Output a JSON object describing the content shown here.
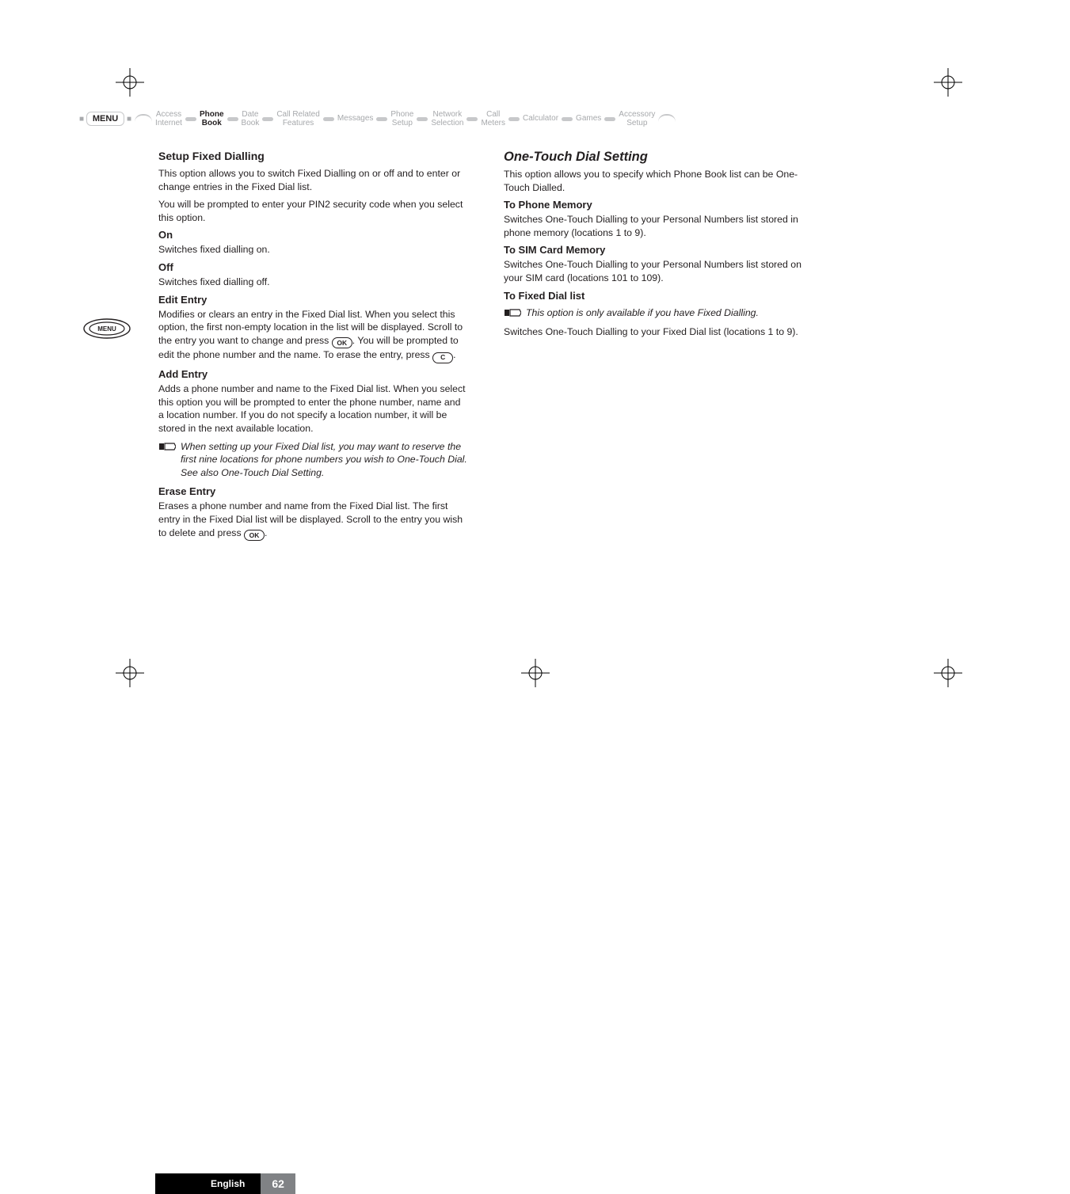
{
  "nav": {
    "menu_label": "MENU",
    "items": [
      {
        "line1": "Access",
        "line2": "Internet"
      },
      {
        "line1": "Phone",
        "line2": "Book",
        "active": true
      },
      {
        "line1": "Date",
        "line2": "Book"
      },
      {
        "line1": "Call Related",
        "line2": "Features"
      },
      {
        "line1": "Messages",
        "line2": ""
      },
      {
        "line1": "Phone",
        "line2": "Setup"
      },
      {
        "line1": "Network",
        "line2": "Selection"
      },
      {
        "line1": "Call",
        "line2": "Meters"
      },
      {
        "line1": "Calculator",
        "line2": ""
      },
      {
        "line1": "Games",
        "line2": ""
      },
      {
        "line1": "Accessory",
        "line2": "Setup"
      }
    ]
  },
  "left": {
    "setup_heading": "Setup Fixed Dialling",
    "p1": "This option allows you to switch Fixed Dialling on or off and to enter or change entries in the Fixed Dial list.",
    "p2": "You will be prompted to enter your PIN2 security code when you select this option.",
    "on_h": "On",
    "on_p": "Switches fixed dialling on.",
    "off_h": "Off",
    "off_p": "Switches fixed dialling off.",
    "edit_h": "Edit Entry",
    "edit_p_a": "Modifies or clears an entry in the Fixed Dial list. When you select this option, the first non-empty location in the list will be displayed. Scroll to the entry you want to change and press ",
    "edit_p_b": ". You will be prompted to edit the phone number and the name. To erase the entry, press ",
    "edit_p_c": ".",
    "key_ok": "OK",
    "key_c": "C",
    "add_h": "Add Entry",
    "add_p": "Adds a phone number and name to the Fixed Dial list. When you select this option you will be prompted to enter the phone number, name and a location number. If you do not specify a location number, it will be stored in the next available location.",
    "add_note": "When setting up your Fixed Dial list, you may want to reserve the first nine locations for phone numbers you wish to One-Touch Dial. See also One-Touch Dial Setting.",
    "erase_h": "Erase Entry",
    "erase_p_a": "Erases a phone number and name from the Fixed Dial list. The first entry in the Fixed Dial list will be displayed. Scroll to the entry you wish to delete and press ",
    "erase_p_b": "."
  },
  "right": {
    "section_h": "One-Touch Dial Setting",
    "p1": "This option allows you to specify which Phone Book list can be One-Touch Dialled.",
    "pm_h": "To Phone Memory",
    "pm_p": "Switches One-Touch Dialling to your Personal Numbers list stored in phone memory (locations 1 to 9).",
    "sim_h": "To SIM Card Memory",
    "sim_p": "Switches One-Touch Dialling to your Personal Numbers list stored on your SIM card (locations 101 to 109).",
    "fd_h": "To Fixed Dial list",
    "fd_note": "This option is only available if you have Fixed Dialling.",
    "fd_p": "Switches One-Touch Dialling to your Fixed Dial list (locations 1 to 9)."
  },
  "side_menu_label": "MENU",
  "footer": {
    "lang": "English",
    "page": "62"
  }
}
